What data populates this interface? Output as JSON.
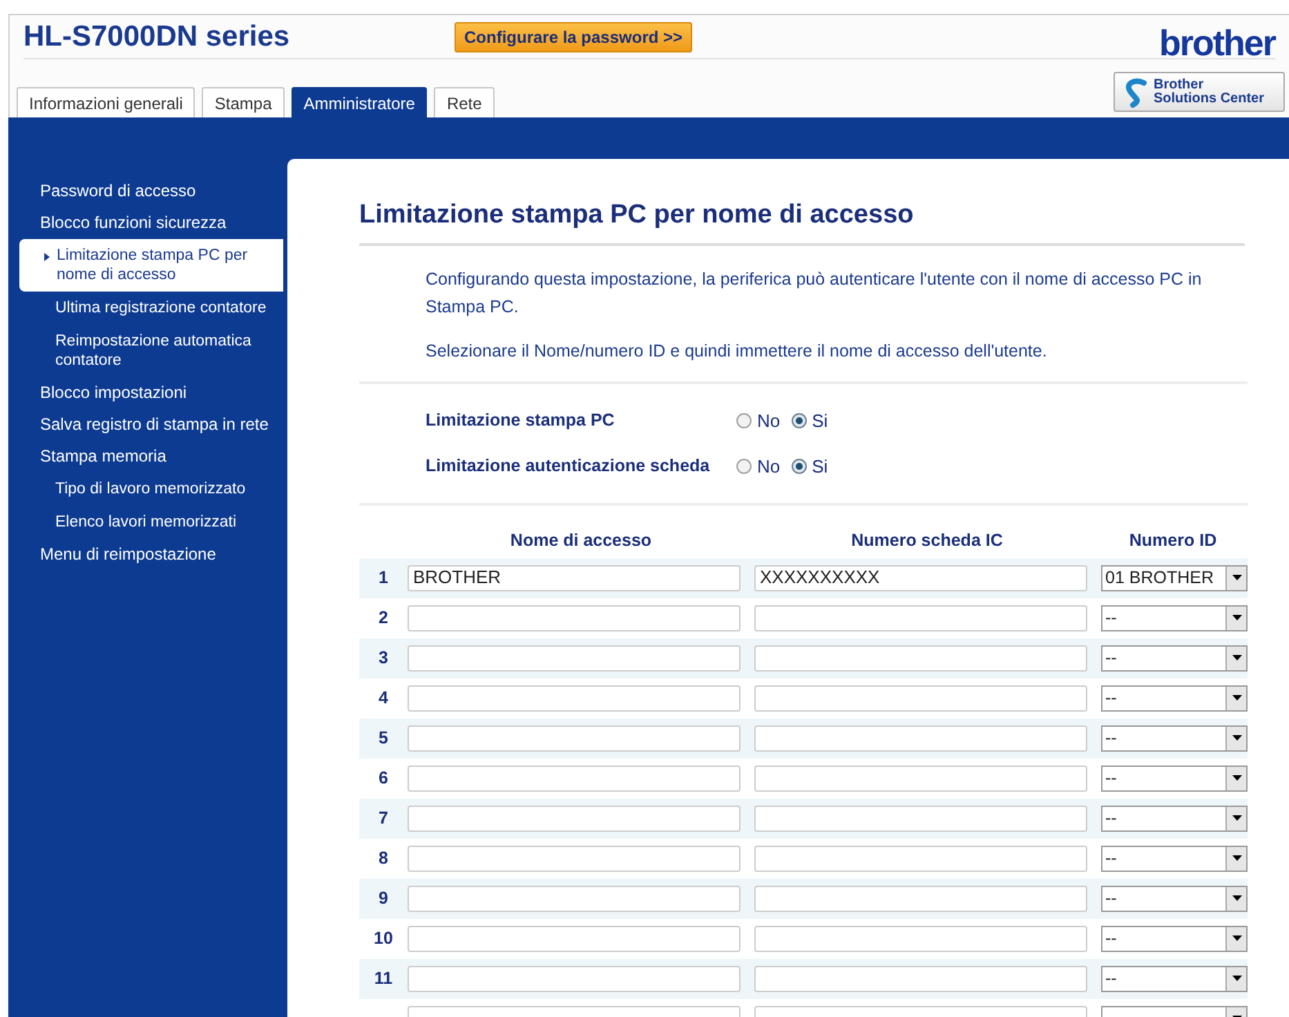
{
  "header": {
    "title": "HL-S7000DN series",
    "password_button": "Configurare la password >>",
    "logo": "brother",
    "solutions_center": {
      "line1": "Brother",
      "line2": "Solutions Center"
    }
  },
  "tabs": [
    {
      "label": "Informazioni generali",
      "selected": false
    },
    {
      "label": "Stampa",
      "selected": false
    },
    {
      "label": "Amministratore",
      "selected": true
    },
    {
      "label": "Rete",
      "selected": false
    }
  ],
  "sidebar": {
    "items": [
      {
        "label": "Password di accesso",
        "selected": false
      },
      {
        "label": "Blocco funzioni sicurezza",
        "selected": false,
        "children": [
          {
            "label": "Limitazione stampa PC per nome di accesso",
            "selected": true
          },
          {
            "label": "Ultima registrazione contatore",
            "selected": false
          },
          {
            "label": "Reimpostazione automatica contatore",
            "selected": false
          }
        ]
      },
      {
        "label": "Blocco impostazioni",
        "selected": false
      },
      {
        "label": "Salva registro di stampa in rete",
        "selected": false
      },
      {
        "label": "Stampa memoria",
        "selected": false,
        "children": [
          {
            "label": "Tipo di lavoro memorizzato",
            "selected": false
          },
          {
            "label": "Elenco lavori memorizzati",
            "selected": false
          }
        ]
      },
      {
        "label": "Menu di reimpostazione",
        "selected": false
      }
    ]
  },
  "content": {
    "title": "Limitazione stampa PC per nome di accesso",
    "paragraphs": [
      "Configurando questa impostazione, la periferica può autenticare l'utente con il nome di accesso PC in Stampa PC.",
      "Selezionare il Nome/numero ID e quindi immettere il nome di accesso dell'utente."
    ],
    "settings": [
      {
        "label": "Limitazione stampa PC",
        "options": [
          {
            "label": "No",
            "selected": false
          },
          {
            "label": "Si",
            "selected": true
          }
        ]
      },
      {
        "label": "Limitazione autenticazione scheda",
        "options": [
          {
            "label": "No",
            "selected": false
          },
          {
            "label": "Si",
            "selected": true
          }
        ]
      }
    ],
    "table": {
      "columns": [
        "Nome di accesso",
        "Numero scheda IC",
        "Numero ID"
      ],
      "rows": [
        {
          "number": "1",
          "name": "BROTHER",
          "card": "XXXXXXXXXX",
          "id": "01 BROTHER"
        },
        {
          "number": "2",
          "id": "--"
        },
        {
          "number": "3",
          "id": "--"
        },
        {
          "number": "4",
          "id": "--"
        },
        {
          "number": "5",
          "id": "--"
        },
        {
          "number": "6",
          "id": "--"
        },
        {
          "number": "7",
          "id": "--"
        },
        {
          "number": "8",
          "id": "--"
        },
        {
          "number": "9",
          "id": "--"
        },
        {
          "number": "10",
          "id": "--"
        },
        {
          "number": "11",
          "id": "--"
        },
        {}
      ]
    }
  }
}
